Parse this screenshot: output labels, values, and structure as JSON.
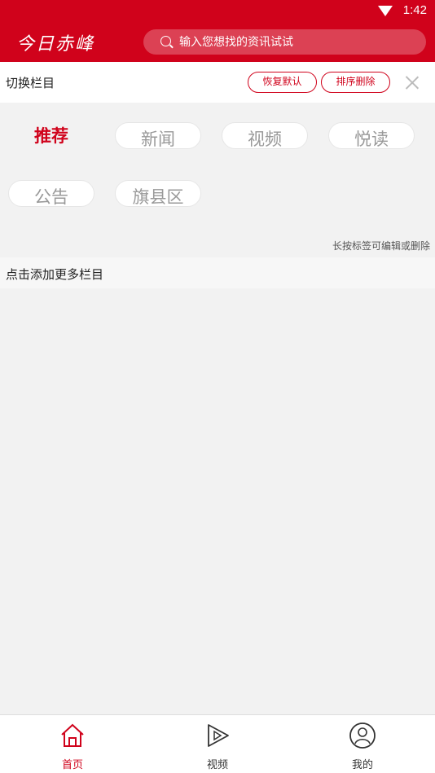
{
  "status": {
    "time": "1:42"
  },
  "header": {
    "logo_text": "今日赤峰",
    "search_placeholder": "输入您想找的资讯试试"
  },
  "toolbar": {
    "title": "切换栏目",
    "restore_label": "恢复默认",
    "sort_label": "排序删除"
  },
  "tags": {
    "items": [
      "推荐",
      "新闻",
      "视频",
      "悦读",
      "公告",
      "旗县区"
    ],
    "active": "推荐",
    "hint": "长按标签可编辑或删除"
  },
  "more": {
    "title": "点击添加更多栏目"
  },
  "tabbar": {
    "tabs": [
      {
        "label": "首页",
        "icon": "home-icon",
        "active": true
      },
      {
        "label": "视频",
        "icon": "play-icon",
        "active": false
      },
      {
        "label": "我的",
        "icon": "user-icon",
        "active": false
      }
    ]
  },
  "colors": {
    "brand": "#d0021b",
    "background": "#f2f2f2"
  }
}
